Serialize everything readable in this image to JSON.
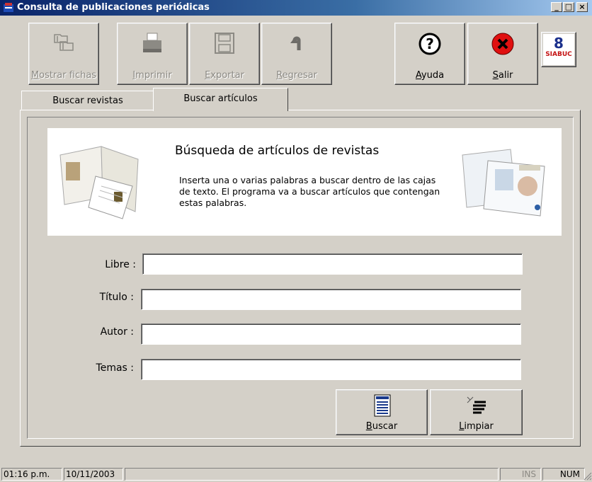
{
  "window": {
    "title": "Consulta de publicaciones periódicas",
    "minimize": "_",
    "maximize": "□",
    "close": "×"
  },
  "toolbar": {
    "mostrar_fichas": {
      "mnemonic": "M",
      "rest": "ostrar fichas",
      "enabled": false,
      "icon": "cards-icon"
    },
    "imprimir": {
      "mnemonic": "I",
      "rest": "mprimir",
      "enabled": false,
      "icon": "printer-icon"
    },
    "exportar": {
      "mnemonic": "E",
      "rest": "xportar",
      "enabled": false,
      "icon": "floppy-disk-icon"
    },
    "regresar": {
      "mnemonic": "R",
      "rest": "egresar",
      "enabled": false,
      "icon": "return-arrow-icon"
    },
    "ayuda": {
      "mnemonic": "A",
      "rest": "yuda",
      "enabled": true,
      "icon": "question-icon"
    },
    "salir": {
      "mnemonic": "S",
      "rest": "alir",
      "enabled": true,
      "icon": "red-x-icon"
    },
    "logo_text": "SIABUC",
    "logo_digit": "8"
  },
  "tabs": [
    {
      "label": "Buscar revistas",
      "active": false
    },
    {
      "label": "Buscar artículos",
      "active": true
    }
  ],
  "banner": {
    "title": "Búsqueda de artículos de revistas",
    "description": "Inserta una o varias palabras a buscar dentro de las cajas de texto. El programa va a buscar artículos que contengan estas palabras."
  },
  "form": {
    "libre": {
      "label": "Libre :",
      "value": ""
    },
    "titulo": {
      "label": "Título :",
      "value": ""
    },
    "autor": {
      "label": "Autor :",
      "value": ""
    },
    "temas": {
      "label": "Temas :",
      "value": ""
    }
  },
  "actions": {
    "buscar": {
      "mnemonic": "B",
      "rest": "uscar",
      "icon": "document-list-icon"
    },
    "limpiar": {
      "mnemonic": "L",
      "rest": "impiar",
      "icon": "clear-lines-icon"
    }
  },
  "statusbar": {
    "time": "01:16 p.m.",
    "date": "10/11/2003",
    "message": "",
    "ins": "INS",
    "num": "NUM"
  },
  "colors": {
    "titlebar": "#0a246a",
    "face": "#d4d0c8",
    "salir_red": "#e01010"
  }
}
